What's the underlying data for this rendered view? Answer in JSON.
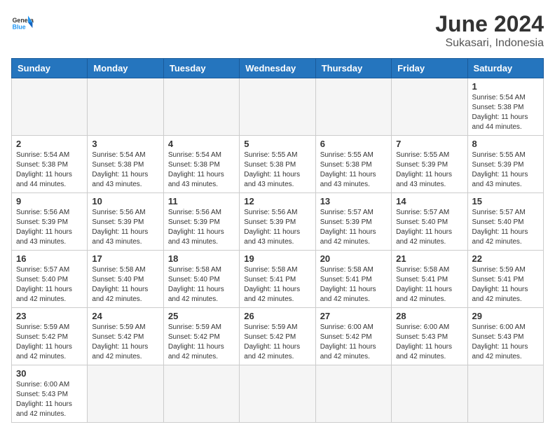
{
  "header": {
    "logo_general": "General",
    "logo_blue": "Blue",
    "month_title": "June 2024",
    "location": "Sukasari, Indonesia"
  },
  "weekdays": [
    "Sunday",
    "Monday",
    "Tuesday",
    "Wednesday",
    "Thursday",
    "Friday",
    "Saturday"
  ],
  "weeks": [
    [
      {
        "day": "",
        "empty": true
      },
      {
        "day": "",
        "empty": true
      },
      {
        "day": "",
        "empty": true
      },
      {
        "day": "",
        "empty": true
      },
      {
        "day": "",
        "empty": true
      },
      {
        "day": "",
        "empty": true
      },
      {
        "day": "1",
        "sunrise": "5:54 AM",
        "sunset": "5:38 PM",
        "daylight": "11 hours and 44 minutes."
      }
    ],
    [
      {
        "day": "2",
        "sunrise": "5:54 AM",
        "sunset": "5:38 PM",
        "daylight": "11 hours and 44 minutes."
      },
      {
        "day": "3",
        "sunrise": "5:54 AM",
        "sunset": "5:38 PM",
        "daylight": "11 hours and 43 minutes."
      },
      {
        "day": "4",
        "sunrise": "5:54 AM",
        "sunset": "5:38 PM",
        "daylight": "11 hours and 43 minutes."
      },
      {
        "day": "5",
        "sunrise": "5:55 AM",
        "sunset": "5:38 PM",
        "daylight": "11 hours and 43 minutes."
      },
      {
        "day": "6",
        "sunrise": "5:55 AM",
        "sunset": "5:38 PM",
        "daylight": "11 hours and 43 minutes."
      },
      {
        "day": "7",
        "sunrise": "5:55 AM",
        "sunset": "5:39 PM",
        "daylight": "11 hours and 43 minutes."
      },
      {
        "day": "8",
        "sunrise": "5:55 AM",
        "sunset": "5:39 PM",
        "daylight": "11 hours and 43 minutes."
      }
    ],
    [
      {
        "day": "9",
        "sunrise": "5:56 AM",
        "sunset": "5:39 PM",
        "daylight": "11 hours and 43 minutes."
      },
      {
        "day": "10",
        "sunrise": "5:56 AM",
        "sunset": "5:39 PM",
        "daylight": "11 hours and 43 minutes."
      },
      {
        "day": "11",
        "sunrise": "5:56 AM",
        "sunset": "5:39 PM",
        "daylight": "11 hours and 43 minutes."
      },
      {
        "day": "12",
        "sunrise": "5:56 AM",
        "sunset": "5:39 PM",
        "daylight": "11 hours and 43 minutes."
      },
      {
        "day": "13",
        "sunrise": "5:57 AM",
        "sunset": "5:39 PM",
        "daylight": "11 hours and 42 minutes."
      },
      {
        "day": "14",
        "sunrise": "5:57 AM",
        "sunset": "5:40 PM",
        "daylight": "11 hours and 42 minutes."
      },
      {
        "day": "15",
        "sunrise": "5:57 AM",
        "sunset": "5:40 PM",
        "daylight": "11 hours and 42 minutes."
      }
    ],
    [
      {
        "day": "16",
        "sunrise": "5:57 AM",
        "sunset": "5:40 PM",
        "daylight": "11 hours and 42 minutes."
      },
      {
        "day": "17",
        "sunrise": "5:58 AM",
        "sunset": "5:40 PM",
        "daylight": "11 hours and 42 minutes."
      },
      {
        "day": "18",
        "sunrise": "5:58 AM",
        "sunset": "5:40 PM",
        "daylight": "11 hours and 42 minutes."
      },
      {
        "day": "19",
        "sunrise": "5:58 AM",
        "sunset": "5:41 PM",
        "daylight": "11 hours and 42 minutes."
      },
      {
        "day": "20",
        "sunrise": "5:58 AM",
        "sunset": "5:41 PM",
        "daylight": "11 hours and 42 minutes."
      },
      {
        "day": "21",
        "sunrise": "5:58 AM",
        "sunset": "5:41 PM",
        "daylight": "11 hours and 42 minutes."
      },
      {
        "day": "22",
        "sunrise": "5:59 AM",
        "sunset": "5:41 PM",
        "daylight": "11 hours and 42 minutes."
      }
    ],
    [
      {
        "day": "23",
        "sunrise": "5:59 AM",
        "sunset": "5:42 PM",
        "daylight": "11 hours and 42 minutes."
      },
      {
        "day": "24",
        "sunrise": "5:59 AM",
        "sunset": "5:42 PM",
        "daylight": "11 hours and 42 minutes."
      },
      {
        "day": "25",
        "sunrise": "5:59 AM",
        "sunset": "5:42 PM",
        "daylight": "11 hours and 42 minutes."
      },
      {
        "day": "26",
        "sunrise": "5:59 AM",
        "sunset": "5:42 PM",
        "daylight": "11 hours and 42 minutes."
      },
      {
        "day": "27",
        "sunrise": "6:00 AM",
        "sunset": "5:42 PM",
        "daylight": "11 hours and 42 minutes."
      },
      {
        "day": "28",
        "sunrise": "6:00 AM",
        "sunset": "5:43 PM",
        "daylight": "11 hours and 42 minutes."
      },
      {
        "day": "29",
        "sunrise": "6:00 AM",
        "sunset": "5:43 PM",
        "daylight": "11 hours and 42 minutes."
      }
    ],
    [
      {
        "day": "30",
        "sunrise": "6:00 AM",
        "sunset": "5:43 PM",
        "daylight": "11 hours and 42 minutes."
      },
      {
        "day": "",
        "empty": true
      },
      {
        "day": "",
        "empty": true
      },
      {
        "day": "",
        "empty": true
      },
      {
        "day": "",
        "empty": true
      },
      {
        "day": "",
        "empty": true
      },
      {
        "day": "",
        "empty": true
      }
    ]
  ]
}
